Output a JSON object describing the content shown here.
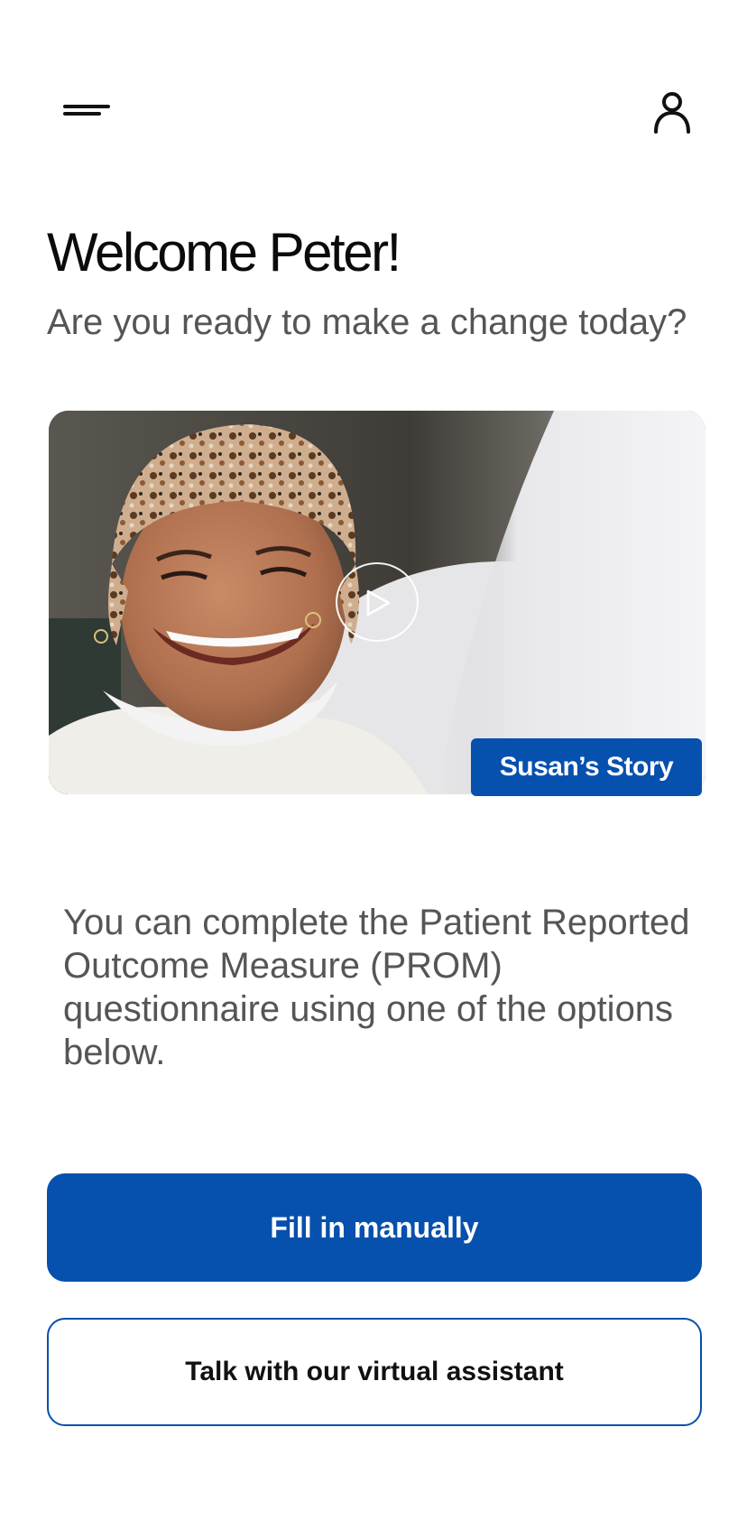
{
  "header": {
    "menu_icon": "menu-icon",
    "profile_icon": "user-icon"
  },
  "welcome": {
    "title": "Welcome Peter!",
    "subtitle": "Are you ready to make a change today?"
  },
  "video": {
    "play_icon": "play-icon",
    "badge_label": "Susan’s Story"
  },
  "info": {
    "text": "You can complete the Patient Reported Outcome Measure (PROM) questionnaire using one of the options below."
  },
  "actions": {
    "primary_label": "Fill in manually",
    "secondary_label": "Talk with our virtual assistant"
  },
  "colors": {
    "brand_blue": "#0650AE",
    "subtitle_gray": "#555555"
  }
}
